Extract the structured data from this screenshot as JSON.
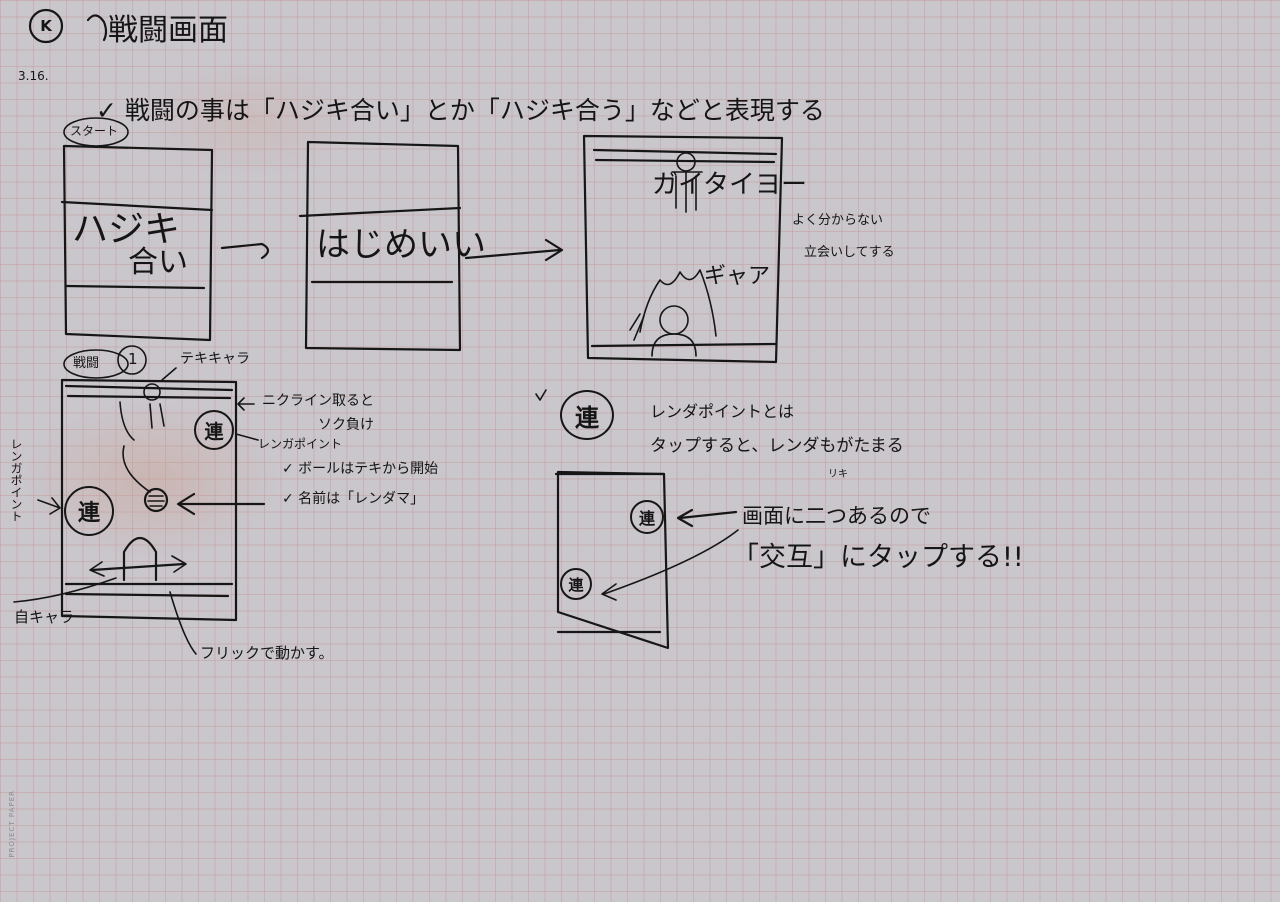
{
  "header": {
    "section_mark": "K",
    "title": "戦闘画面",
    "date": "3.16."
  },
  "intro_note": "✓ 戦闘の事は「ハジキ合い」とか「ハジキ合う」などと表現する",
  "intro_panels": {
    "start_label": "スタート",
    "panel1_line1": "ハジキ",
    "panel1_line2": "合い",
    "panel2_text": "はじめいい",
    "panel3_top_text": "ガイタイヨー",
    "panel3_bottom_text": "ギャア",
    "side_note_line1": "よく分からない",
    "side_note_line2": "立会いしてする"
  },
  "battle_screen": {
    "tab_label": "戦闘",
    "tab_number": "1",
    "enemy_char_label": "テキキャラ",
    "line_note_line1": "ニクライン取ると",
    "line_note_line2": "ソク負け",
    "renga_label_right": "レンガポイント",
    "renga_label_left": "レンガポイント",
    "ball_note_line1": "✓ ボールはテキから開始",
    "ball_note_line2": "✓ 名前は「レンダマ」",
    "renga_char": "連",
    "own_char_label": "自キャラ",
    "flick_note": "フリックで動かす。"
  },
  "renga_section": {
    "check": "✓",
    "renga_char": "連",
    "desc_line1": "レンダポイントとは",
    "desc_line2": "タップすると、レンダもがたまる",
    "desc_sub": "リキ",
    "tap_note_line1": "画面に二つあるので",
    "tap_note_line2": "「交互」にタップする!!"
  },
  "footer": {
    "brand": "PROJECT PAPER"
  }
}
